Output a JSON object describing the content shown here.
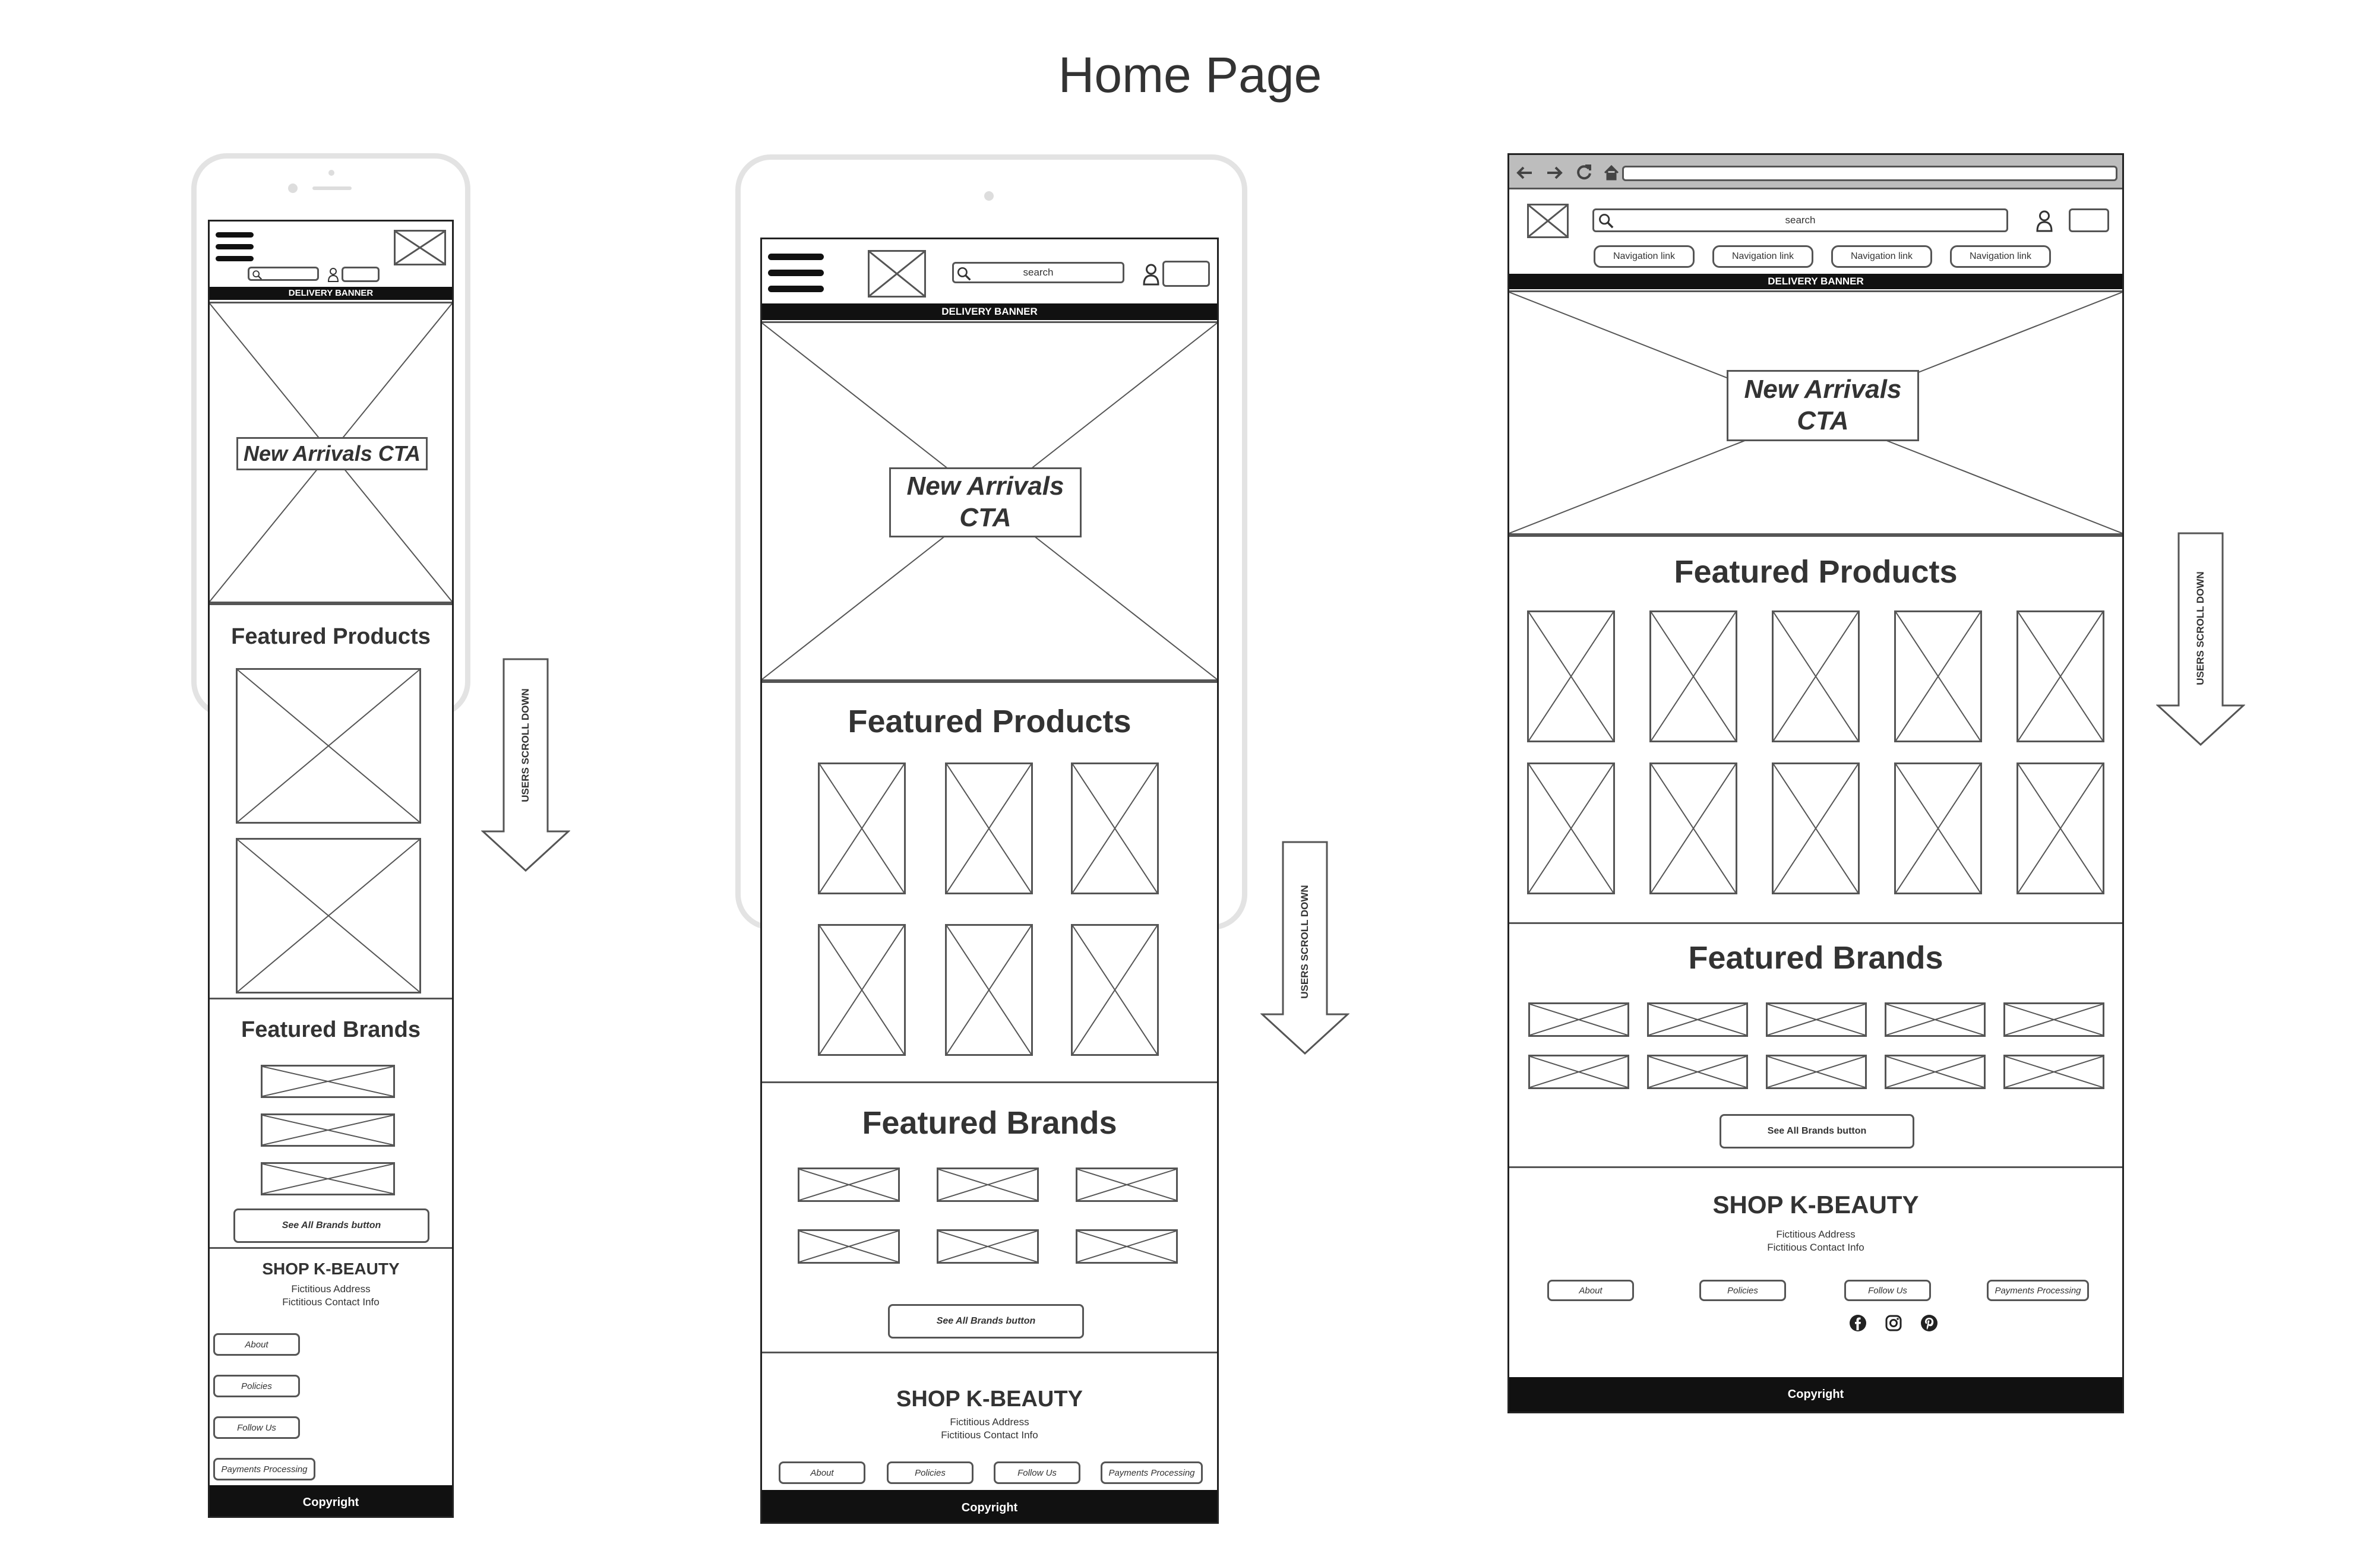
{
  "page": {
    "title": "Home Page"
  },
  "colors": {
    "outline": "#555555",
    "frame": "#e3e3e3",
    "banner": "#111111",
    "text": "#333333"
  },
  "common": {
    "delivery_banner": "DELIVERY BANNER",
    "cta_one_line": "New Arrivals CTA",
    "cta_line1": "New Arrivals",
    "cta_line2": "CTA",
    "featured_products": "Featured Products",
    "featured_brands": "Featured Brands",
    "see_all_brands": "See All Brands button",
    "shop_name": "SHOP K-BEAUTY",
    "address": "Fictitious Address",
    "contact": "Fictitious Contact Info",
    "about": "About",
    "policies": "Policies",
    "follow_us": "Follow Us",
    "payments": "Payments Processing",
    "copyright": "Copyright",
    "search": "search",
    "scroll_hint": "USERS SCROLL DOWN",
    "nav_link": "Navigation link"
  },
  "icons": {
    "hamburger": "hamburger-menu-icon",
    "search": "magnifier-icon",
    "user": "user-icon",
    "cart": "cart-icon",
    "logo": "logo-placeholder-icon",
    "social": [
      "facebook-icon",
      "instagram-icon",
      "pinterest-icon"
    ],
    "browser": [
      "back-arrow-icon",
      "forward-arrow-icon",
      "reload-icon",
      "home-icon"
    ]
  }
}
